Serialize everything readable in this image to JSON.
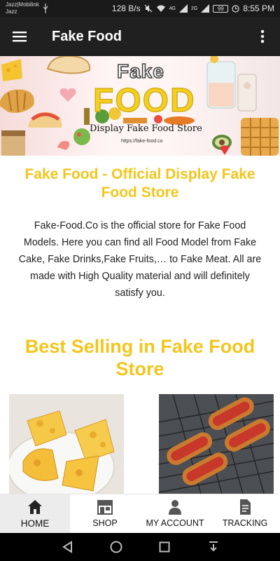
{
  "status_bar": {
    "carrier_line1": "Jazz|Mobilink",
    "carrier_line2": "Jazz",
    "network_speed": "128 B/s",
    "signal_label_1": "4G",
    "signal_label_2": "2G",
    "battery_level": "99",
    "time": "8:55 PM"
  },
  "app_bar": {
    "title": "Fake Food",
    "menu_icon": "hamburger-menu-icon",
    "overflow_icon": "more-vertical-icon"
  },
  "banner": {
    "line1": "Fake",
    "line2": "FOOD",
    "tagline": "Display Fake Food Store",
    "url": "https://fake-food.co"
  },
  "intro": {
    "heading": "Fake Food - Official Display Fake Food Store",
    "text": "Fake-Food.Co is the official store for Fake Food Models. Here you can find all Food Model from Fake Cake, Fake Drinks,Fake Fruits,… to Fake Meat. All are made with High Quality material and will definitely satisfy you."
  },
  "best_selling": {
    "heading": "Best Selling in Fake Food Store"
  },
  "bottom_nav": {
    "items": [
      {
        "label": "HOME",
        "icon": "home-icon",
        "active": true
      },
      {
        "label": "SHOP",
        "icon": "shop-icon",
        "active": false
      },
      {
        "label": "MY ACCOUNT",
        "icon": "user-icon",
        "active": false
      },
      {
        "label": "TRACKING",
        "icon": "document-icon",
        "active": false
      }
    ]
  },
  "colors": {
    "accent": "#f3c61d",
    "app_bar": "#202020",
    "status_bar": "#1a1a1a",
    "nav_active": "#ececec"
  }
}
